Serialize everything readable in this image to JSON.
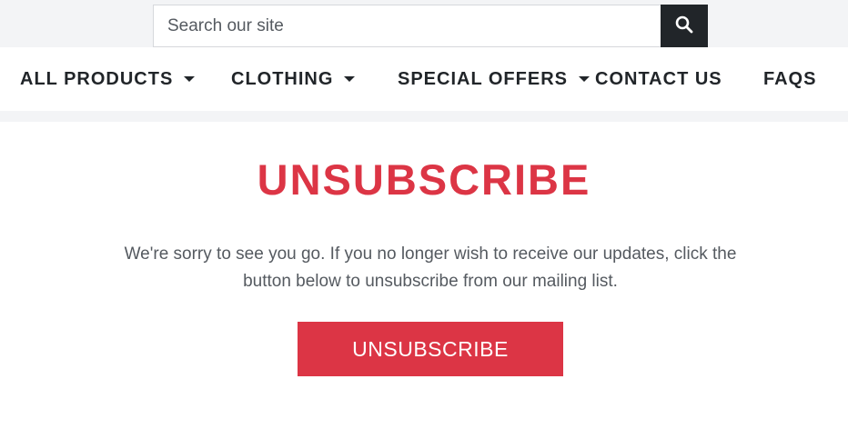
{
  "search": {
    "placeholder": "Search our site",
    "value": "",
    "icon": "search-icon"
  },
  "nav": {
    "items": [
      {
        "label": "ALL PRODUCTS",
        "dropdown": true
      },
      {
        "label": "CLOTHING",
        "dropdown": true
      },
      {
        "label": "SPECIAL OFFERS",
        "dropdown": true
      },
      {
        "label": "CONTACT US",
        "dropdown": false
      },
      {
        "label": "FAQS",
        "dropdown": false
      }
    ]
  },
  "main": {
    "title": "UNSUBSCRIBE",
    "message": "We're sorry to see you go. If you no longer wish to receive our updates, click the button below to unsubscribe from our mailing list.",
    "button_label": "UNSUBSCRIBE"
  },
  "colors": {
    "accent": "#dc3545",
    "dark": "#212529",
    "topbar_bg": "#f3f4f6"
  }
}
